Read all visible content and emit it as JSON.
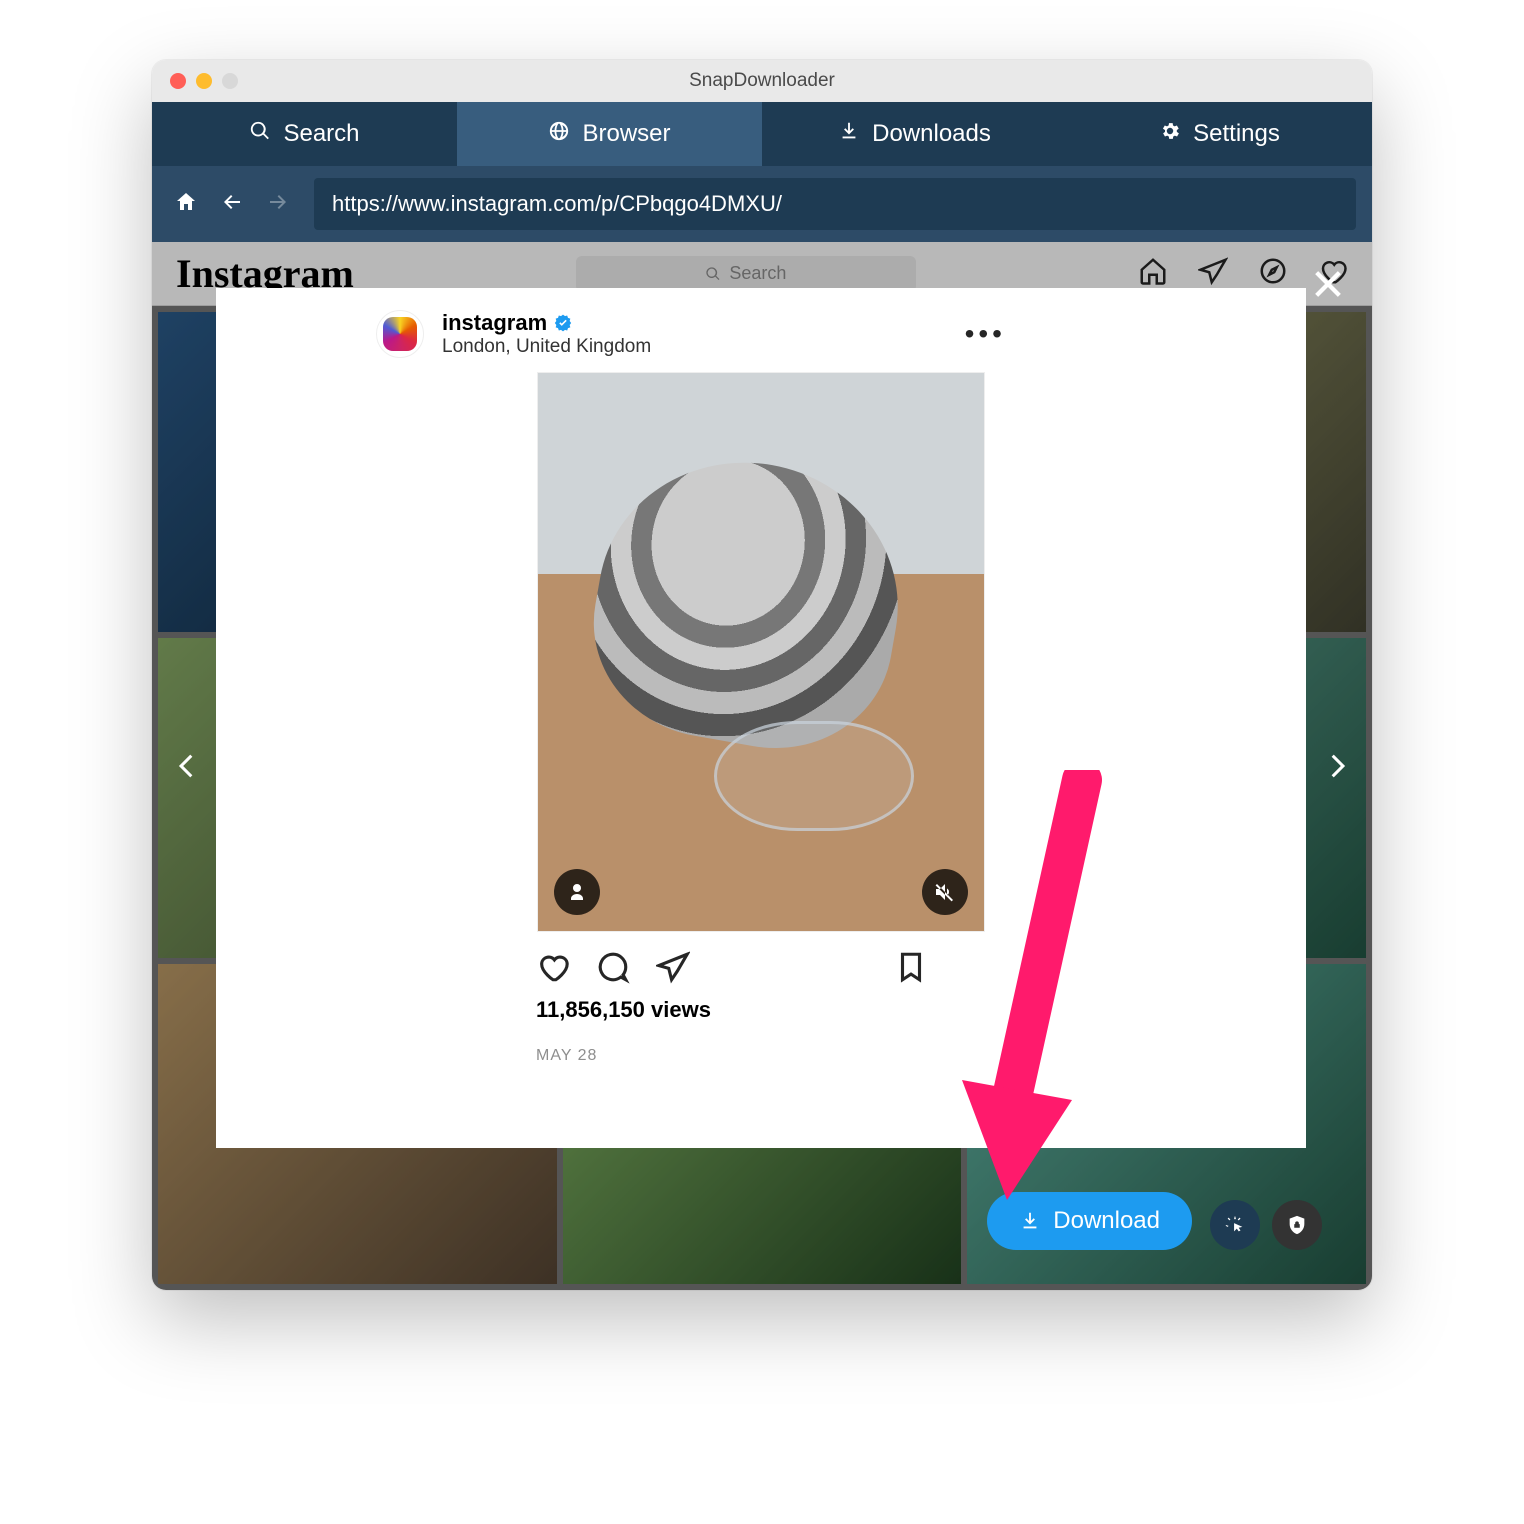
{
  "window": {
    "title": "SnapDownloader"
  },
  "tabs": {
    "items": [
      "Search",
      "Browser",
      "Downloads",
      "Settings"
    ],
    "active_index": 1
  },
  "nav": {
    "url": "https://www.instagram.com/p/CPbqgo4DMXU/"
  },
  "instagram": {
    "logo": "Instagram",
    "search_placeholder": "Search"
  },
  "post": {
    "username": "instagram",
    "verified": true,
    "location": "London, United Kingdom",
    "views_text": "11,856,150 views",
    "date_text": "MAY 28"
  },
  "download": {
    "label": "Download"
  },
  "colors": {
    "tabbar": "#1e3b53",
    "tabactive": "#385d7e",
    "navbar": "#2d4b67",
    "primary": "#1d9bf0",
    "arrow": "#ff1a6c"
  }
}
